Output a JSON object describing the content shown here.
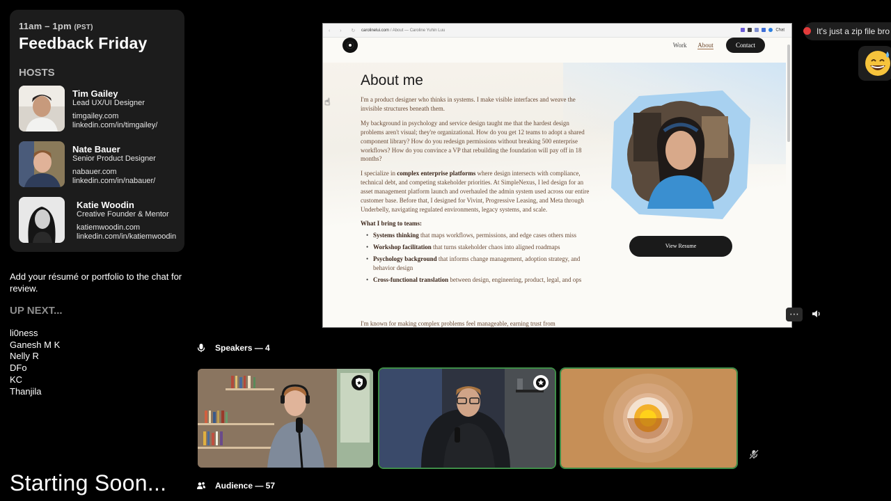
{
  "event": {
    "time": "11am – 1pm",
    "time_zone": "(PST)",
    "title": "Feedback Friday",
    "hosts_heading": "HOSTS",
    "hosts": [
      {
        "name": "Tim Gailey",
        "role": "Lead UX/UI Designer",
        "site": "timgailey.com",
        "linkedin": "linkedin.com/in/timgailey/"
      },
      {
        "name": "Nate Bauer",
        "role": "Senior Product Designer",
        "site": "nabauer.com",
        "linkedin": "linkedin.com/in/nabauer/"
      },
      {
        "name": "Katie Woodin",
        "role": "Creative Founder & Mentor",
        "site": "katiemwoodin.com",
        "linkedin": "linkedin.com/in/katiemwoodin"
      }
    ],
    "note": "Add your résumé or portfolio to the chat for review.",
    "up_next_heading": "UP NEXT...",
    "up_next": [
      "li0ness",
      "Ganesh M K",
      "Nelly R",
      "DFo",
      "KC",
      "Thanjila"
    ],
    "starting": "Starting Soon..."
  },
  "browser": {
    "url_domain": "carolinelui.com",
    "url_rest": " / About — Caroline Yuhin Luu",
    "chat_ext_label": "Chat"
  },
  "site": {
    "nav": {
      "work": "Work",
      "about": "About",
      "contact": "Contact"
    },
    "title": "About me",
    "paragraphs": [
      "I'm a product designer who thinks in systems. I make visible interfaces and weave the invisible structures beneath them.",
      "My background in psychology and service design taught me that the hardest design problems aren't visual; they're organizational. How do you get 12 teams to adopt a shared component library? How do you redesign permissions without breaking 500 enterprise workflows? How do you convince a VP that rebuilding the foundation will pay off in 18 months?"
    ],
    "p3": {
      "pre": "I specialize in ",
      "bold": "complex enterprise platforms",
      "post": " where design intersects with compliance, technical debt, and competing stakeholder priorities. At SimpleNexus, I led design for an asset management platform launch and overhauled the admin system used across our entire customer base. Before that, I designed for Vivint, Progressive Leasing, and Meta through Underbelly, navigating regulated environments, legacy systems, and scale."
    },
    "bring_heading": "What I bring to teams:",
    "bring_items": [
      {
        "bold": "Systems thinking",
        "text": " that maps workflows, permissions, and edge cases others miss"
      },
      {
        "bold": "Workshop facilitation",
        "text": " that turns stakeholder chaos into aligned roadmaps"
      },
      {
        "bold": "Psychology background",
        "text": " that informs change management, adoption strategy, and behavior design"
      },
      {
        "bold": "Cross-functional translation",
        "text": " between design, engineering, product, legal, and ops"
      }
    ],
    "cut_line": "I'm known for making complex problems feel manageable, earning trust from",
    "resume_button": "View Resume"
  },
  "chat": {
    "message": "It's just a zip file bro"
  },
  "stage": {
    "speakers_label": "Speakers — 4",
    "audience_label": "Audience — 57"
  },
  "colors": {
    "card_bg": "#1c1c1c",
    "speaking_ring": "#3f8e48",
    "audio_tile_bg": "#c68f57"
  }
}
